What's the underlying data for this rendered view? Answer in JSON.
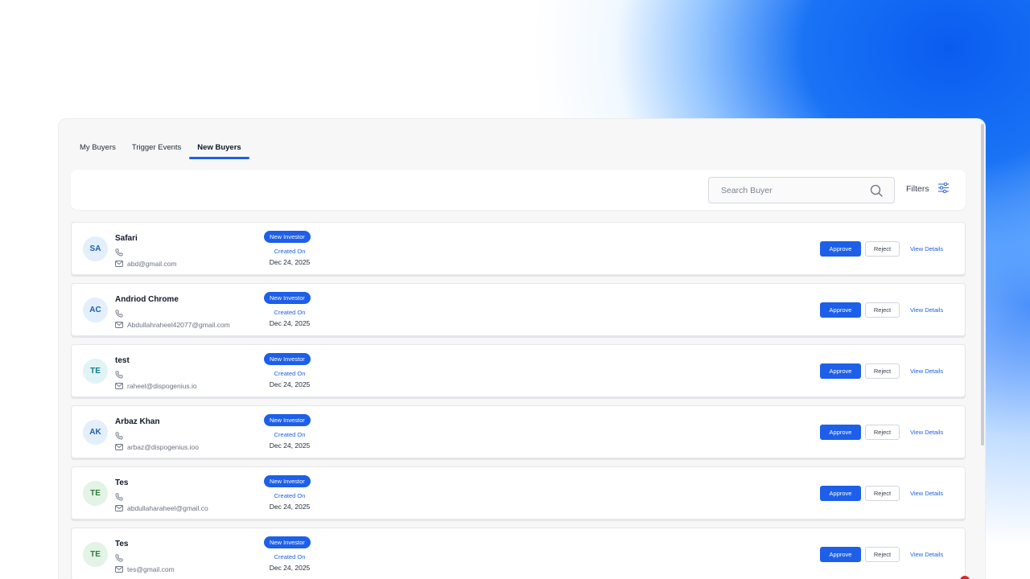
{
  "tabs": [
    {
      "label": "My Buyers",
      "active": false
    },
    {
      "label": "Trigger Events",
      "active": false
    },
    {
      "label": "New Buyers",
      "active": true
    }
  ],
  "search": {
    "placeholder": "Search Buyer",
    "value": ""
  },
  "filters": {
    "label": "Filters"
  },
  "row_labels": {
    "badge": "New Investor",
    "created_label": "Created On",
    "approve": "Approve",
    "reject": "Reject",
    "view_details": "View Details"
  },
  "colors": {
    "accent": "#1d5fe9",
    "avatar_blue_bg": "#e3effc",
    "avatar_blue_fg": "#1f5fa8",
    "avatar_teal_bg": "#e0f3f5",
    "avatar_teal_fg": "#127c86",
    "avatar_green_bg": "#e3f3e6",
    "avatar_green_fg": "#2f7d3d"
  },
  "buyers": [
    {
      "initials": "SA",
      "name": "Safari",
      "email": "abd@gmail.com",
      "date": "Dec 24, 2025",
      "avatar_theme": "blue"
    },
    {
      "initials": "AC",
      "name": "Andriod Chrome",
      "email": "Abdullahraheel42077@gmail.com",
      "date": "Dec 24, 2025",
      "avatar_theme": "blue"
    },
    {
      "initials": "TE",
      "name": "test",
      "email": "raheel@dispogenius.io",
      "date": "Dec 24, 2025",
      "avatar_theme": "teal"
    },
    {
      "initials": "AK",
      "name": "Arbaz Khan",
      "email": "arbaz@dispogenius.ioo",
      "date": "Dec 24, 2025",
      "avatar_theme": "blue"
    },
    {
      "initials": "TE",
      "name": "Tes",
      "email": "abdullaharaheel@gmail.co",
      "date": "Dec 24, 2025",
      "avatar_theme": "green"
    },
    {
      "initials": "TE",
      "name": "Tes",
      "email": "tes@gmail.com",
      "date": "Dec 24, 2025",
      "avatar_theme": "green"
    }
  ]
}
